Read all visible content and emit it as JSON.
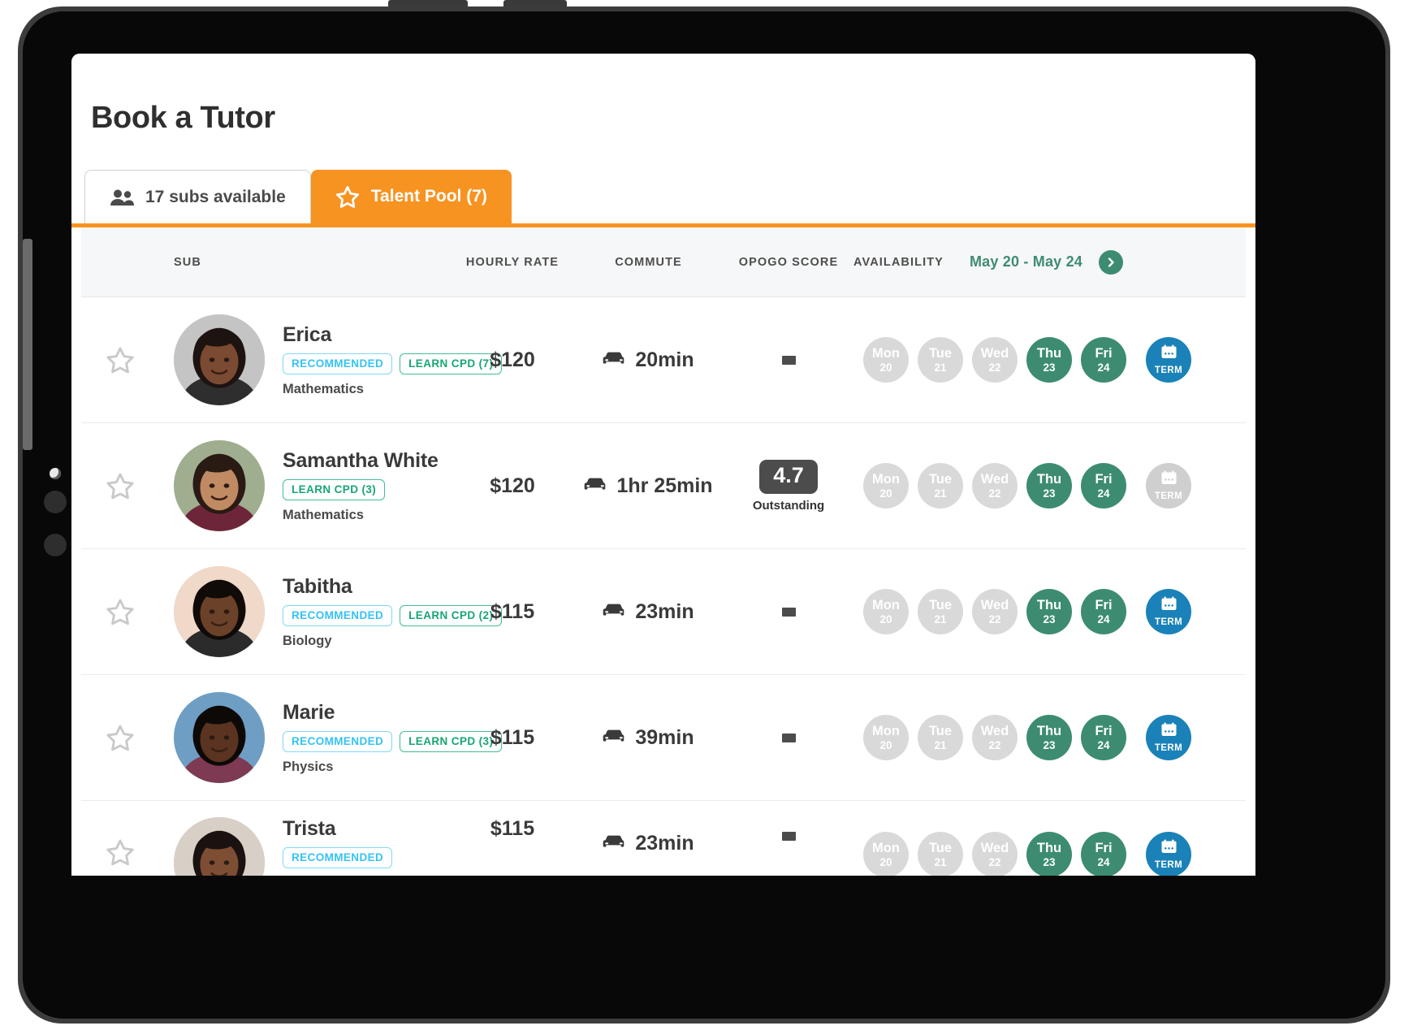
{
  "page": {
    "title": "Book a Tutor"
  },
  "tabs": [
    {
      "label": "17 subs available",
      "icon": "people-icon",
      "active": false
    },
    {
      "label": "Talent Pool (7)",
      "icon": "star-icon",
      "active": true
    }
  ],
  "table": {
    "headers": {
      "sub": "SUB",
      "hourly_rate": "HOURLY RATE",
      "commute": "COMMUTE",
      "opogo_score": "OPOGO SCORE",
      "availability": "AVAILABILITY"
    },
    "date_range": "May 20 - May 24",
    "next_icon": "chevron-right-icon"
  },
  "colors": {
    "accent_orange": "#f79321",
    "green": "#3d8c72",
    "blue_term": "#1a82b8",
    "badge_recommended": "#35c3f3",
    "badge_cpd": "#17a673",
    "day_off": "#d9d9d9",
    "score_chip": "#4c4c4c"
  },
  "rows": [
    {
      "name": "Erica",
      "badges": [
        {
          "type": "recommended",
          "label": "RECOMMENDED"
        },
        {
          "type": "cpd",
          "label": "LEARN CPD (7)"
        }
      ],
      "subject": "Mathematics",
      "rate": "$120",
      "commute": "20min",
      "score": null,
      "score_label": null,
      "days": [
        {
          "name": "Mon",
          "num": "20",
          "available": false
        },
        {
          "name": "Tue",
          "num": "21",
          "available": false
        },
        {
          "name": "Wed",
          "num": "22",
          "available": false
        },
        {
          "name": "Thu",
          "num": "23",
          "available": true
        },
        {
          "name": "Fri",
          "num": "24",
          "available": true
        }
      ],
      "term": {
        "label": "TERM",
        "active": true
      },
      "starred": false,
      "avatar": {
        "skin": "#7a4a32",
        "hair": "#1d1310",
        "bg": "#c4c4c4",
        "top": "#2e2e2e"
      }
    },
    {
      "name": "Samantha White",
      "badges": [
        {
          "type": "cpd",
          "label": "LEARN CPD (3)"
        }
      ],
      "subject": "Mathematics",
      "rate": "$120",
      "commute": "1hr 25min",
      "score": "4.7",
      "score_label": "Outstanding",
      "days": [
        {
          "name": "Mon",
          "num": "20",
          "available": false
        },
        {
          "name": "Tue",
          "num": "21",
          "available": false
        },
        {
          "name": "Wed",
          "num": "22",
          "available": false
        },
        {
          "name": "Thu",
          "num": "23",
          "available": true
        },
        {
          "name": "Fri",
          "num": "24",
          "available": true
        }
      ],
      "term": {
        "label": "TERM",
        "active": false
      },
      "starred": false,
      "avatar": {
        "skin": "#c08a63",
        "hair": "#2a1a14",
        "bg": "#9fae8f",
        "top": "#6d2639"
      }
    },
    {
      "name": "Tabitha",
      "badges": [
        {
          "type": "recommended",
          "label": "RECOMMENDED"
        },
        {
          "type": "cpd",
          "label": "LEARN CPD (2)"
        }
      ],
      "subject": "Biology",
      "rate": "$115",
      "commute": "23min",
      "score": null,
      "score_label": null,
      "days": [
        {
          "name": "Mon",
          "num": "20",
          "available": false
        },
        {
          "name": "Tue",
          "num": "21",
          "available": false
        },
        {
          "name": "Wed",
          "num": "22",
          "available": false
        },
        {
          "name": "Thu",
          "num": "23",
          "available": true
        },
        {
          "name": "Fri",
          "num": "24",
          "available": true
        }
      ],
      "term": {
        "label": "TERM",
        "active": true
      },
      "starred": false,
      "avatar": {
        "skin": "#6b4129",
        "hair": "#100b09",
        "bg": "#f0d9c8",
        "top": "#2b2b2b"
      }
    },
    {
      "name": "Marie",
      "badges": [
        {
          "type": "recommended",
          "label": "RECOMMENDED"
        },
        {
          "type": "cpd",
          "label": "LEARN CPD (3)"
        }
      ],
      "subject": "Physics",
      "rate": "$115",
      "commute": "39min",
      "score": null,
      "score_label": null,
      "days": [
        {
          "name": "Mon",
          "num": "20",
          "available": false
        },
        {
          "name": "Tue",
          "num": "21",
          "available": false
        },
        {
          "name": "Wed",
          "num": "22",
          "available": false
        },
        {
          "name": "Thu",
          "num": "23",
          "available": true
        },
        {
          "name": "Fri",
          "num": "24",
          "available": true
        }
      ],
      "term": {
        "label": "TERM",
        "active": true
      },
      "starred": false,
      "avatar": {
        "skin": "#5a3420",
        "hair": "#0d0907",
        "bg": "#6f9ec4",
        "top": "#7d3a52"
      }
    },
    {
      "name": "Trista",
      "badges": [
        {
          "type": "recommended",
          "label": "RECOMMENDED"
        }
      ],
      "subject": "",
      "rate": "$115",
      "commute": "23min",
      "score": null,
      "score_label": null,
      "days": [
        {
          "name": "Mon",
          "num": "20",
          "available": false
        },
        {
          "name": "Tue",
          "num": "21",
          "available": false
        },
        {
          "name": "Wed",
          "num": "22",
          "available": false
        },
        {
          "name": "Thu",
          "num": "23",
          "available": true
        },
        {
          "name": "Fri",
          "num": "24",
          "available": true
        }
      ],
      "term": {
        "label": "TERM",
        "active": true
      },
      "starred": false,
      "avatar": {
        "skin": "#7d4e33",
        "hair": "#1a1210",
        "bg": "#d8cfc6",
        "top": "#3a3a3a"
      }
    }
  ]
}
